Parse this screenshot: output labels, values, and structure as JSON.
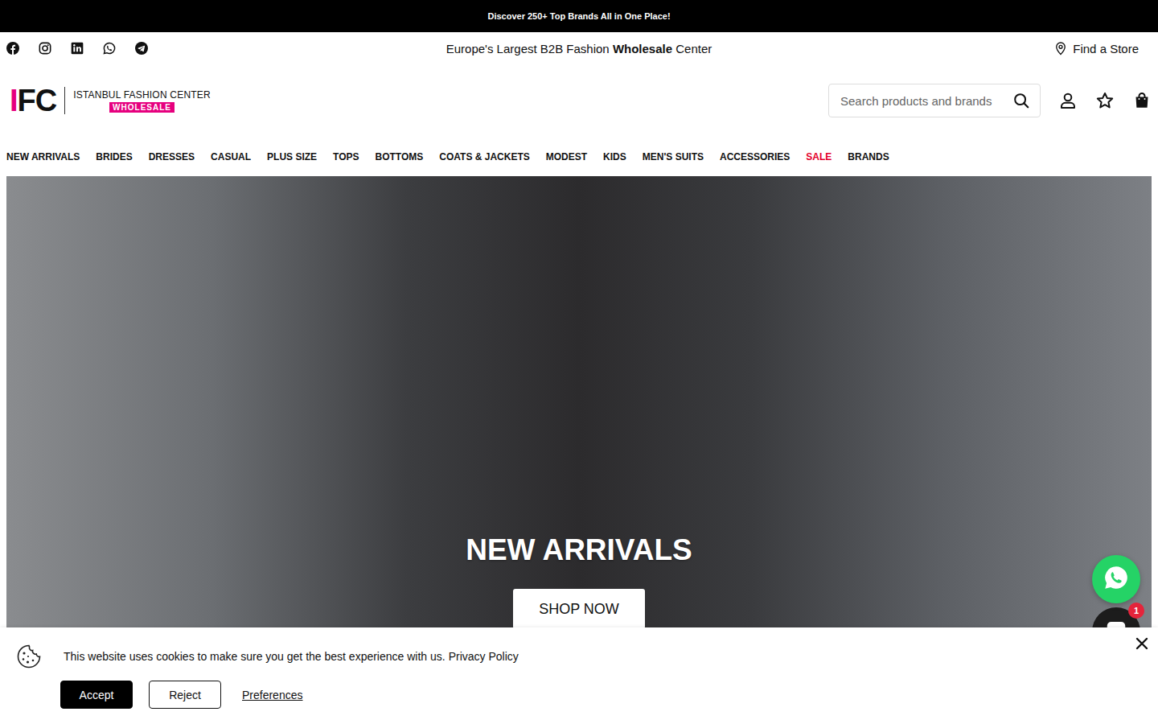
{
  "announcement": "Discover 250+ Top Brands All in One Place!",
  "tagline": [
    {
      "text": "Europe's Largest B2B Fashion ",
      "bold": false
    },
    {
      "text": "Wholesale",
      "bold": true
    },
    {
      "text": " Center",
      "bold": false
    }
  ],
  "store_link": "Find a Store",
  "logo": {
    "letters": [
      {
        "text": "I",
        "color": "#e6007e"
      },
      {
        "text": "FC",
        "color": "#111111"
      }
    ],
    "name": "ISTANBUL FASHION CENTER",
    "badge": "WHOLESALE"
  },
  "search": {
    "placeholder": "Search products and brands"
  },
  "nav": [
    {
      "label": "NEW ARRIVALS",
      "color": "#111111"
    },
    {
      "label": "BRIDES",
      "color": "#111111"
    },
    {
      "label": "DRESSES",
      "color": "#111111"
    },
    {
      "label": "CASUAL",
      "color": "#111111"
    },
    {
      "label": "PLUS SIZE",
      "color": "#111111"
    },
    {
      "label": "TOPS",
      "color": "#111111"
    },
    {
      "label": "BOTTOMS",
      "color": "#111111"
    },
    {
      "label": "COATS & JACKETS",
      "color": "#111111"
    },
    {
      "label": "MODEST",
      "color": "#111111"
    },
    {
      "label": "KIDS",
      "color": "#111111"
    },
    {
      "label": "MEN'S SUITS",
      "color": "#111111"
    },
    {
      "label": "ACCESSORIES",
      "color": "#111111"
    },
    {
      "label": "SALE",
      "color": "#e4002b"
    },
    {
      "label": "BRANDS",
      "color": "#111111"
    }
  ],
  "hero": {
    "title": "NEW ARRIVALS",
    "button": "SHOP NOW"
  },
  "chat": {
    "badge": "1"
  },
  "cookie": {
    "message": "This website uses cookies to make sure you get the best experience with us.",
    "link": "Privacy Policy",
    "buttons": [
      {
        "label": "Accept",
        "kind": "primary"
      },
      {
        "label": "Reject",
        "kind": "secondary"
      },
      {
        "label": "Preferences",
        "kind": "link"
      }
    ]
  }
}
